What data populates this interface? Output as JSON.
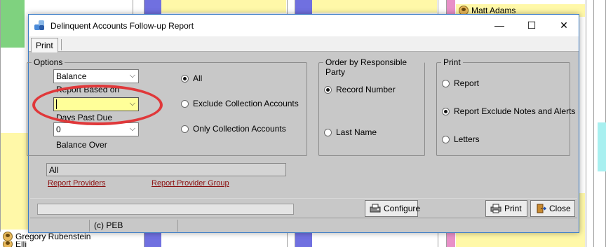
{
  "background": {
    "appointments": {
      "top_right_patient": "Matt Adams",
      "bottom_left_patient": "Gregory Rubenstein",
      "bottom_left_next": "Elli"
    }
  },
  "dialog": {
    "title": "Delinquent Accounts Follow-up Report",
    "window_controls": {
      "minimize": "—",
      "maximize": "☐",
      "close": "✕"
    },
    "tabs": [
      "Print"
    ],
    "options": {
      "group_label": "Options",
      "report_based_on_value": "Balance",
      "report_based_on_label": "Report Based on",
      "days_past_due_value": "",
      "days_past_due_label": "Days Past Due",
      "balance_over_value": "0",
      "balance_over_label": "Balance Over",
      "radios": [
        {
          "label": "All",
          "selected": true
        },
        {
          "label": "Exclude Collection Accounts",
          "selected": false
        },
        {
          "label": "Only Collection Accounts",
          "selected": false
        }
      ]
    },
    "order_by": {
      "group_label": "Order by Responsible Party",
      "radios": [
        {
          "label": "Record Number",
          "selected": true
        },
        {
          "label": "Last Name",
          "selected": false
        }
      ]
    },
    "print": {
      "group_label": "Print",
      "radios": [
        {
          "label": "Report",
          "selected": false
        },
        {
          "label": "Report Exclude Notes and Alerts",
          "selected": true
        },
        {
          "label": "Letters",
          "selected": false
        }
      ]
    },
    "providers": {
      "value": "All",
      "link_providers": "Report Providers",
      "link_provider_group": "Report Provider Group"
    },
    "buttons": {
      "configure": "Configure",
      "print": "Print",
      "close": "Close"
    },
    "footer": {
      "copyright": "(c) PEB"
    },
    "annotation": {
      "color": "#e0383a"
    }
  }
}
